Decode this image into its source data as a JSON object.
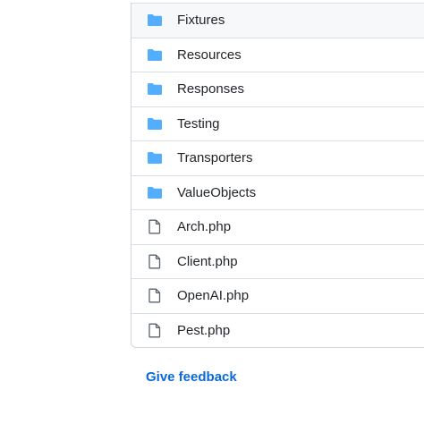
{
  "entries": [
    {
      "type": "folder",
      "icon": "folder-icon",
      "name": "Fixtures"
    },
    {
      "type": "folder",
      "icon": "folder-icon",
      "name": "Resources"
    },
    {
      "type": "folder",
      "icon": "folder-icon",
      "name": "Responses"
    },
    {
      "type": "folder",
      "icon": "folder-icon",
      "name": "Testing"
    },
    {
      "type": "folder",
      "icon": "folder-icon",
      "name": "Transporters"
    },
    {
      "type": "folder",
      "icon": "folder-icon",
      "name": "ValueObjects"
    },
    {
      "type": "file",
      "icon": "file-icon",
      "name": "Arch.php"
    },
    {
      "type": "file",
      "icon": "file-icon",
      "name": "Client.php"
    },
    {
      "type": "file",
      "icon": "file-icon",
      "name": "OpenAI.php"
    },
    {
      "type": "file",
      "icon": "file-icon",
      "name": "Pest.php"
    }
  ],
  "feedback_link": "Give feedback",
  "colors": {
    "folder": "#54aeff",
    "file_icon": "#59636e",
    "link": "#0969da",
    "border": "#d0d7de"
  }
}
